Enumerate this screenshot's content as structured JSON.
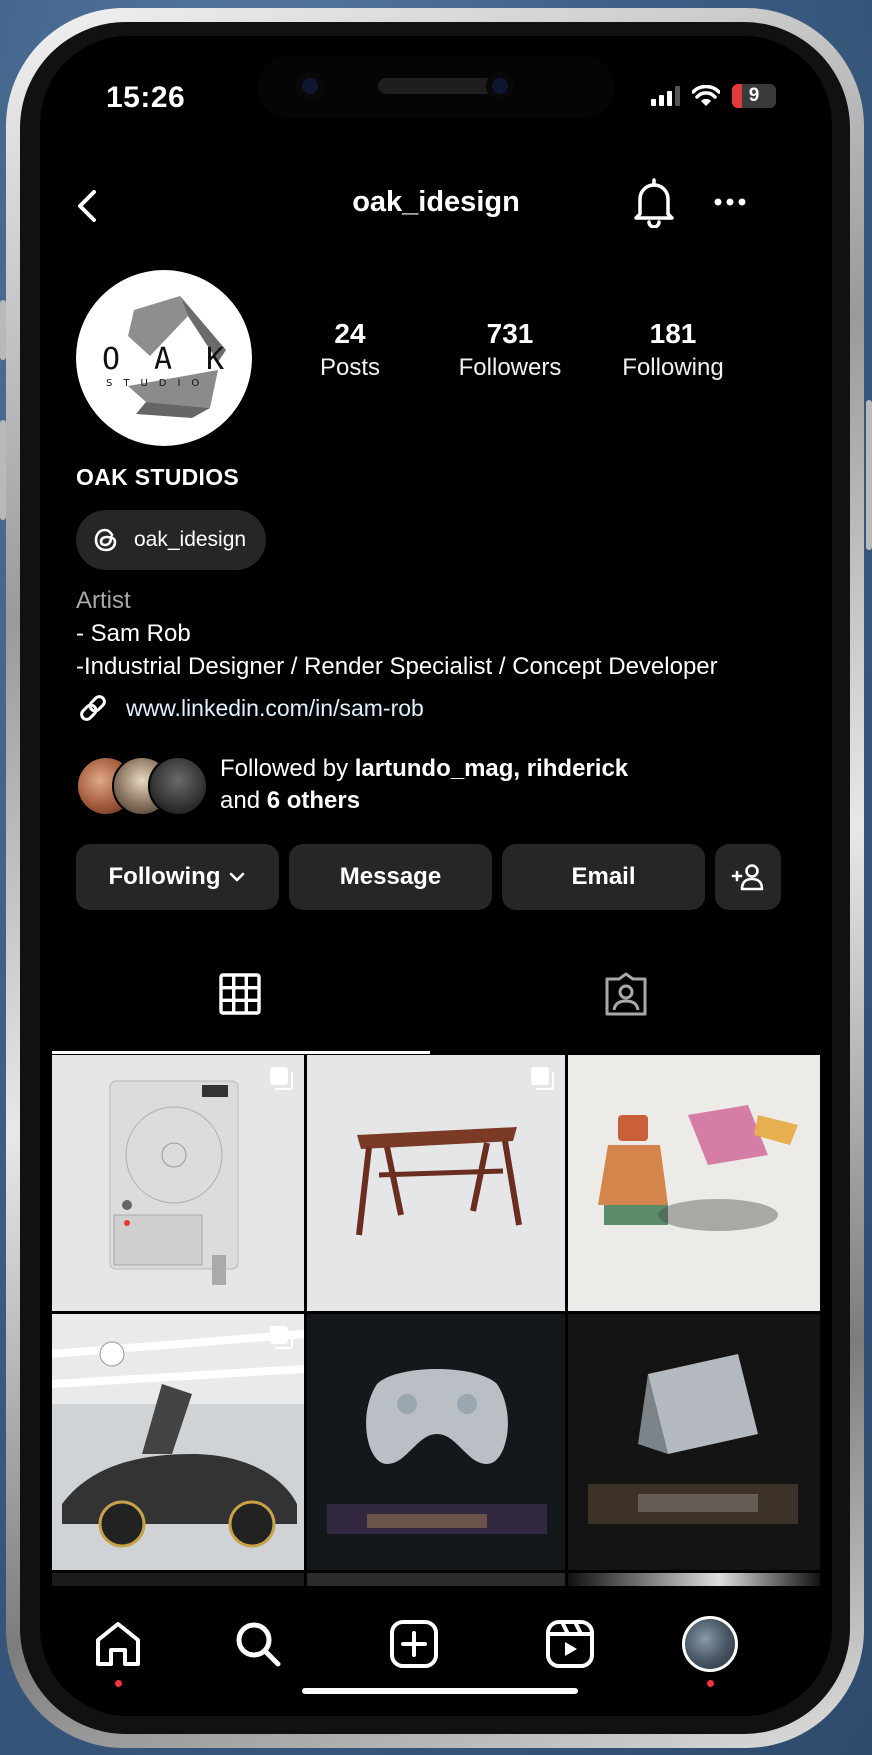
{
  "status": {
    "time": "15:26",
    "battery": "9"
  },
  "header": {
    "username": "oak_idesign"
  },
  "profile": {
    "avatar_lettering": "O A K STUDIO",
    "stats": [
      {
        "value": "24",
        "label": "Posts"
      },
      {
        "value": "731",
        "label": "Followers"
      },
      {
        "value": "181",
        "label": "Following"
      }
    ],
    "display_name": "OAK STUDIOS",
    "threads_handle": "oak_idesign",
    "category": "Artist",
    "bio_lines": [
      "- Sam Rob",
      "-Industrial Designer / Render Specialist / Concept Developer"
    ],
    "link": "www.linkedin.com/in/sam-rob",
    "followed_by": {
      "prefix": "Followed by ",
      "names": "lartundo_mag, rihderick",
      "and": "and ",
      "others": "6 others"
    }
  },
  "actions": {
    "following": "Following",
    "message": "Message",
    "email": "Email"
  },
  "posts": [
    {
      "subject": "portable device render",
      "multi": true
    },
    {
      "subject": "wooden desk render",
      "multi": true
    },
    {
      "subject": "glass bottles render",
      "multi": false
    },
    {
      "subject": "sports car render",
      "multi": true
    },
    {
      "subject": "clear game controller render",
      "multi": false
    },
    {
      "subject": "clear handheld console render",
      "multi": false
    }
  ],
  "colors": {
    "background": "#000000",
    "button": "#262626",
    "notification_dot": "#ff3040",
    "link": "#e0f1ff"
  },
  "icons": [
    "back-icon",
    "bell-icon",
    "more-icon",
    "threads-icon",
    "link-icon",
    "chevron-down-icon",
    "add-person-icon",
    "grid-icon",
    "tagged-icon",
    "home-icon",
    "search-icon",
    "create-icon",
    "reels-icon",
    "profile-icon"
  ]
}
